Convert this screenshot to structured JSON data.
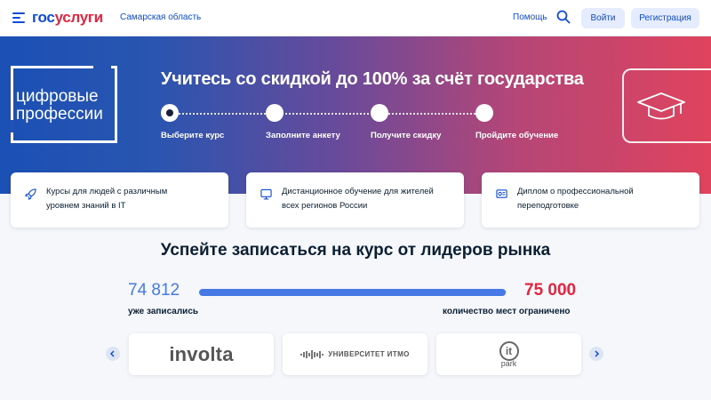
{
  "header": {
    "logo_part1": "гос",
    "logo_part2": "услуги",
    "region": "Самарская область",
    "help": "Помощь",
    "login": "Войти",
    "register": "Регистрация"
  },
  "hero": {
    "brand_line1": "цифровые",
    "brand_line2": "профессии",
    "title": "Учитесь со скидкой до 100% за счёт государства",
    "steps": [
      {
        "label": "Выберите курс",
        "active": true
      },
      {
        "label": "Заполните анкету",
        "active": false
      },
      {
        "label": "Получите скидку",
        "active": false
      },
      {
        "label": "Пройдите обучение",
        "active": false
      }
    ]
  },
  "features": [
    {
      "icon": "rocket-icon",
      "line1": "Курсы для людей с различным",
      "line2": "уровнем знаний в IT"
    },
    {
      "icon": "monitor-icon",
      "line1": "Дистанционное обучение для жителей",
      "line2": "всех регионов России"
    },
    {
      "icon": "diploma-icon",
      "line1": "Диплом о профессиональной",
      "line2": "переподготовке"
    }
  ],
  "enrollment": {
    "title": "Успейте записаться на курс от лидеров рынка",
    "enrolled": "74 812",
    "enrolled_label": "уже записались",
    "limit": "75 000",
    "limit_label": "количество мест ограничено",
    "fill_fraction": 0.998
  },
  "partners": [
    {
      "name": "involta"
    },
    {
      "name": "УНИВЕРСИТЕТ ИТМО"
    },
    {
      "name": "it",
      "sub": "park"
    }
  ],
  "colors": {
    "brand_blue": "#0d4cd3",
    "brand_red": "#e3253f",
    "progress_blue": "#4779e6"
  }
}
